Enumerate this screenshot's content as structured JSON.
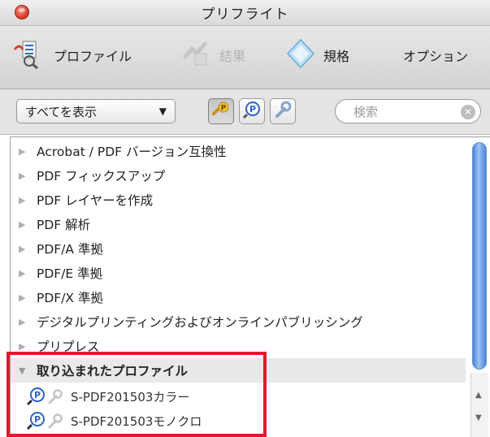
{
  "window": {
    "title": "プリフライト"
  },
  "toolbar": {
    "tabs": [
      {
        "label": "プロファイル",
        "icon": "profiles-icon",
        "enabled": true
      },
      {
        "label": "結果",
        "icon": "results-icon",
        "enabled": false
      },
      {
        "label": "規格",
        "icon": "standards-icon",
        "enabled": true
      },
      {
        "label": "オプション",
        "icon": "options-icon",
        "enabled": true
      }
    ]
  },
  "filter": {
    "select_value": "すべてを表示",
    "search_placeholder": "検索",
    "buttons": [
      {
        "icon": "fixups-filter-icon",
        "active": true
      },
      {
        "icon": "profile-p-icon",
        "active": false
      },
      {
        "icon": "wrench-icon",
        "active": false
      }
    ]
  },
  "list": {
    "groups": [
      "Acrobat / PDF バージョン互換性",
      "PDF フィックスアップ",
      "PDF レイヤーを作成",
      "PDF 解析",
      "PDF/A 準拠",
      "PDF/E 準拠",
      "PDF/X 準拠",
      "デジタルプリンティングおよびオンラインパブリッシング",
      "プリプレス"
    ],
    "selected_group": "取り込まれたプロファイル",
    "profiles": [
      "S-PDF201503カラー",
      "S-PDF201503モノクロ"
    ]
  },
  "colors": {
    "scroll_blue": "#4a82d6",
    "highlight_red": "#e8152e"
  }
}
